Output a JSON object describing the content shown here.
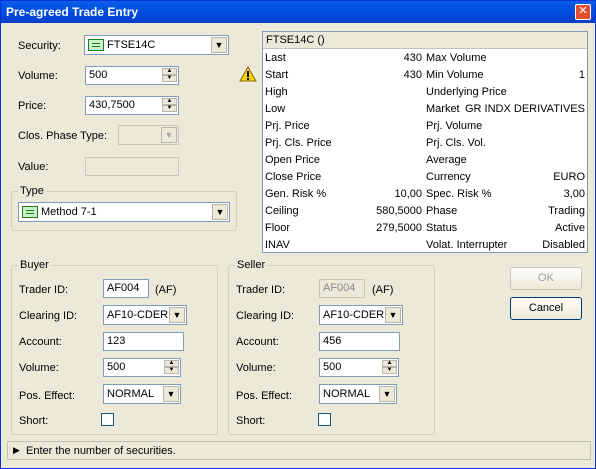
{
  "window": {
    "title": "Pre-agreed Trade Entry",
    "close_glyph": "✕"
  },
  "form": {
    "security_label": "Security:",
    "security_value": "FTSE14C",
    "volume_label": "Volume:",
    "volume_value": "500",
    "price_label": "Price:",
    "price_value": "430,7500",
    "clos_phase_label": "Clos. Phase Type:",
    "value_label": "Value:"
  },
  "type_group": {
    "title": "Type",
    "value": "Method 7-1"
  },
  "info": {
    "header": "FTSE14C ()",
    "rows": [
      {
        "l": "Last",
        "lv": "430",
        "r": "Max Volume",
        "rv": ""
      },
      {
        "l": "Start",
        "lv": "430",
        "r": "Min Volume",
        "rv": "1"
      },
      {
        "l": "High",
        "lv": "",
        "r": "Underlying Price",
        "rv": ""
      },
      {
        "l": "Low",
        "lv": "",
        "r": "Market",
        "rv": "GR INDX DERIVATIVES"
      },
      {
        "l": "Prj. Price",
        "lv": "",
        "r": "Prj. Volume",
        "rv": ""
      },
      {
        "l": "Prj. Cls. Price",
        "lv": "",
        "r": "Prj. Cls. Vol.",
        "rv": ""
      },
      {
        "l": "Open Price",
        "lv": "",
        "r": "Average",
        "rv": ""
      },
      {
        "l": "Close Price",
        "lv": "",
        "r": "Currency",
        "rv": "EURO"
      },
      {
        "l": "Gen. Risk %",
        "lv": "10,00",
        "r": "Spec. Risk %",
        "rv": "3,00"
      },
      {
        "l": "Ceiling",
        "lv": "580,5000",
        "r": "Phase",
        "rv": "Trading"
      },
      {
        "l": "Floor",
        "lv": "279,5000",
        "r": "Status",
        "rv": "Active"
      },
      {
        "l": "INAV",
        "lv": "",
        "r": "Volat. Interrupter",
        "rv": "Disabled"
      }
    ]
  },
  "buyer": {
    "title": "Buyer",
    "trader_label": "Trader ID:",
    "trader_value": "AF004",
    "trader_suffix": "(AF)",
    "clearing_label": "Clearing ID:",
    "clearing_value": "AF10-CDER",
    "account_label": "Account:",
    "account_value": "123",
    "volume_label": "Volume:",
    "volume_value": "500",
    "pos_label": "Pos. Effect:",
    "pos_value": "NORMAL",
    "short_label": "Short:"
  },
  "seller": {
    "title": "Seller",
    "trader_label": "Trader ID:",
    "trader_value": "AF004",
    "trader_suffix": "(AF)",
    "clearing_label": "Clearing ID:",
    "clearing_value": "AF10-CDER",
    "account_label": "Account:",
    "account_value": "456",
    "volume_label": "Volume:",
    "volume_value": "500",
    "pos_label": "Pos. Effect:",
    "pos_value": "NORMAL",
    "short_label": "Short:"
  },
  "buttons": {
    "ok": "OK",
    "cancel": "Cancel"
  },
  "status": {
    "message": "Enter the number of securities."
  },
  "icons": {
    "warning": "warning-icon",
    "security": "instrument-icon"
  }
}
